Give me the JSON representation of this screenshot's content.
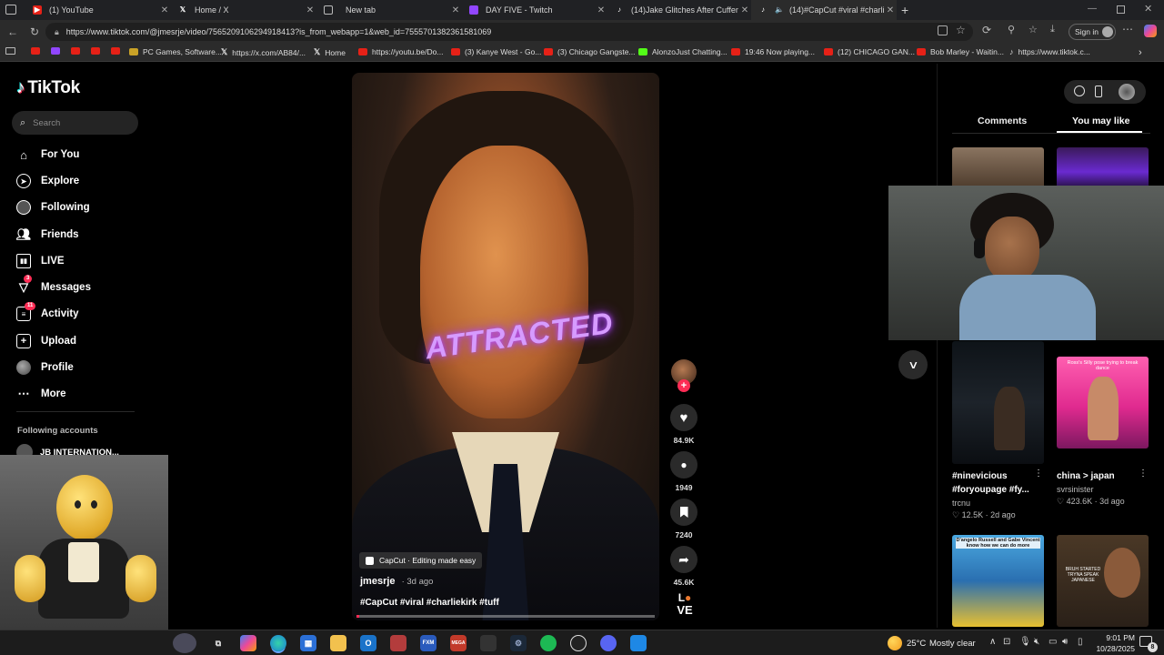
{
  "browser": {
    "tabs": [
      {
        "label": "(1) YouTube",
        "icon": "youtube-icon"
      },
      {
        "label": "Home / X",
        "icon": "x-icon"
      },
      {
        "label": "New tab",
        "icon": "newtab-icon"
      },
      {
        "label": "DAY FIVE - Twitch",
        "icon": "twitch-icon"
      },
      {
        "label": "(14)Jake Glitches After Cuffem Fa",
        "icon": "tiktok-icon"
      },
      {
        "label": "(14)#CapCut #viral #charliek",
        "icon": "tiktok-icon"
      }
    ],
    "url": "https://www.tiktok.com/@jmesrje/video/7565209106294918413?is_from_webapp=1&web_id=7555701382361581069",
    "signin_label": "Sign in",
    "bookmarks": [
      {
        "label": "PC Games, Software..."
      },
      {
        "label": "https://x.com/AB84/..."
      },
      {
        "label": "Home"
      },
      {
        "label": "https://youtu.be/Do..."
      },
      {
        "label": "(3) Kanye West - Go..."
      },
      {
        "label": "(3) Chicago Gangste..."
      },
      {
        "label": "AlonzoJust Chatting..."
      },
      {
        "label": "19:46 Now playing..."
      },
      {
        "label": "(12) CHICAGO GAN..."
      },
      {
        "label": "Bob Marley - Waitin..."
      },
      {
        "label": "https://www.tiktok.c..."
      }
    ]
  },
  "tiktok": {
    "logo": "TikTok",
    "search_placeholder": "Search",
    "nav": [
      {
        "label": "For You",
        "icon": "home-icon"
      },
      {
        "label": "Explore",
        "icon": "compass-icon"
      },
      {
        "label": "Following",
        "icon": "following-icon"
      },
      {
        "label": "Friends",
        "icon": "friends-icon"
      },
      {
        "label": "LIVE",
        "icon": "live-icon"
      },
      {
        "label": "Messages",
        "icon": "messages-icon",
        "badge": "3"
      },
      {
        "label": "Activity",
        "icon": "activity-icon",
        "badge": "11"
      },
      {
        "label": "Upload",
        "icon": "upload-icon"
      },
      {
        "label": "Profile",
        "icon": "profile-icon"
      },
      {
        "label": "More",
        "icon": "more-icon"
      }
    ],
    "following_accounts_heading": "Following accounts",
    "following_accounts": [
      "JB INTERNATION..."
    ],
    "video": {
      "overlay_text": "ATTRACTED",
      "capcut_label": "CapCut · Editing made easy",
      "author": "jmesrje",
      "age": "· 3d ago",
      "caption": "#CapCut #viral #charliekirk #tuff",
      "progress": 0.01,
      "likes": "84.9K",
      "comments": "1949",
      "saves": "7240",
      "shares": "45.6K",
      "corner_text_top": "L",
      "corner_text_bottom": "VE"
    },
    "panel_tabs": {
      "comments": "Comments",
      "you_may_like": "You may like"
    },
    "recommended": [
      {
        "title": "#ninevicious #foryoupage #fy...",
        "author": "trcnu",
        "likes": "12.5K",
        "age": "2d ago"
      },
      {
        "title": "china > japan",
        "author": "svrsinister",
        "likes": "423.6K",
        "age": "3d ago"
      }
    ],
    "thumb_caption_1": "Ross's Silly pose trying to break dance",
    "thumb_caption_2": "D'angelo Russell and Gabe Vincent know how we can do more",
    "thumb_caption_3": "BRUH STARTED TRYNA SPEAK JAPANESE"
  },
  "taskbar": {
    "weather_temp": "25°C",
    "weather_desc": "Mostly clear",
    "time": "9:01 PM",
    "date": "10/28/2025",
    "notifications": "8"
  }
}
